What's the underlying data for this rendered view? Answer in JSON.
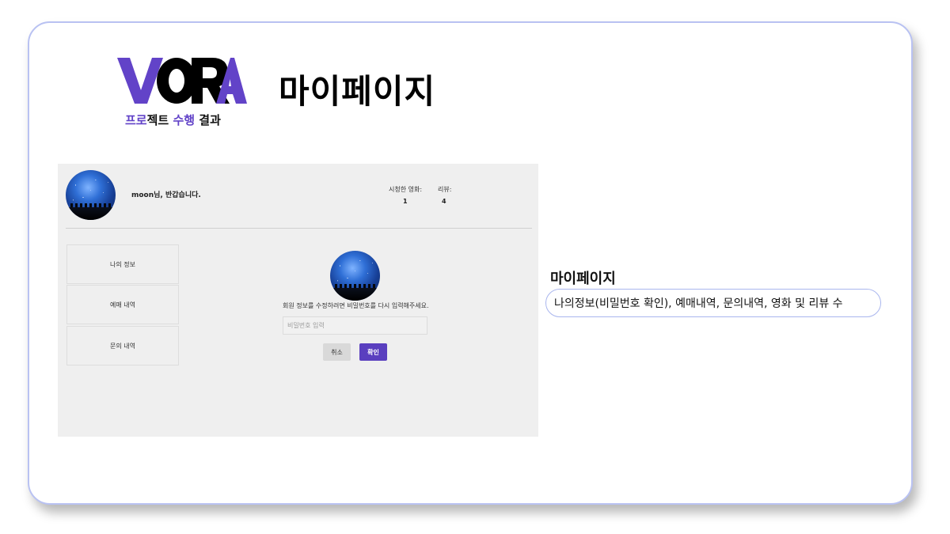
{
  "brand": {
    "logo_text": "VORA",
    "subtitle_purple_1": "프로",
    "subtitle_dark_1": "젝트",
    "subtitle_purple_2": "수행",
    "subtitle_dark_2": "결과",
    "colors": {
      "purple": "#6243c8",
      "dark": "#111111"
    }
  },
  "page_title": "마이페이지",
  "screenshot": {
    "greeting": "moon님, 반갑습니다.",
    "stats": {
      "watched_label": "시청한 영화:",
      "watched_value": "1",
      "reviews_label": "리뷰:",
      "reviews_value": "4"
    },
    "sidebar": [
      {
        "label": "나의 정보"
      },
      {
        "label": "예매 내역"
      },
      {
        "label": "문의 내역"
      }
    ],
    "confirm_message": "회원 정보를 수정하려면 비밀번호를 다시 입력해주세요.",
    "password_placeholder": "비밀번호 입력",
    "cancel_label": "취소",
    "confirm_label": "확인",
    "colors": {
      "panel_bg": "#efefef",
      "confirm_button": "#5a3fbf",
      "cancel_button": "#d9d9d9"
    }
  },
  "annotation": {
    "title": "마이페이지",
    "description": "나의정보(비밀번호 확인), 예매내역, 문의내역, 영화 및 리뷰 수",
    "border_color": "#a9b6ee"
  }
}
